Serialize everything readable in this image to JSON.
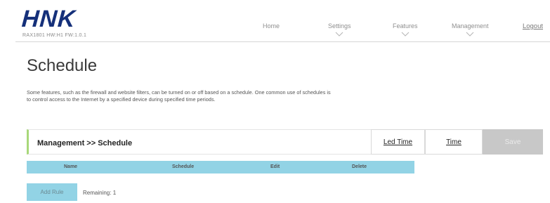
{
  "header": {
    "logo": "HNK",
    "model_info": "RAX1801 HW:H1 FW:1.0.1",
    "nav": [
      {
        "label": "Home"
      },
      {
        "label": "Settings"
      },
      {
        "label": "Features"
      },
      {
        "label": "Management"
      }
    ],
    "logout_label": "Logout"
  },
  "main": {
    "title": "Schedule",
    "description": "Some features, such as the firewall and website filters, can be turned on or off based on a schedule. One common use of schedules is to control access to the Internet by a specified device during specified time periods.",
    "section_title": "Management >> Schedule",
    "tabs": {
      "led_time": "Led Time",
      "time": "Time",
      "save": "Save"
    },
    "table": {
      "columns": [
        "Name",
        "Schedule",
        "Edit",
        "Delete"
      ]
    },
    "add_rule_label": "Add Rule",
    "remaining_text": "Remaining: 1"
  },
  "colors": {
    "logo": "#15307a",
    "accent_table": "#92d3e5",
    "section_marker": "#a8d87a",
    "save_disabled": "#c8c8c8"
  }
}
